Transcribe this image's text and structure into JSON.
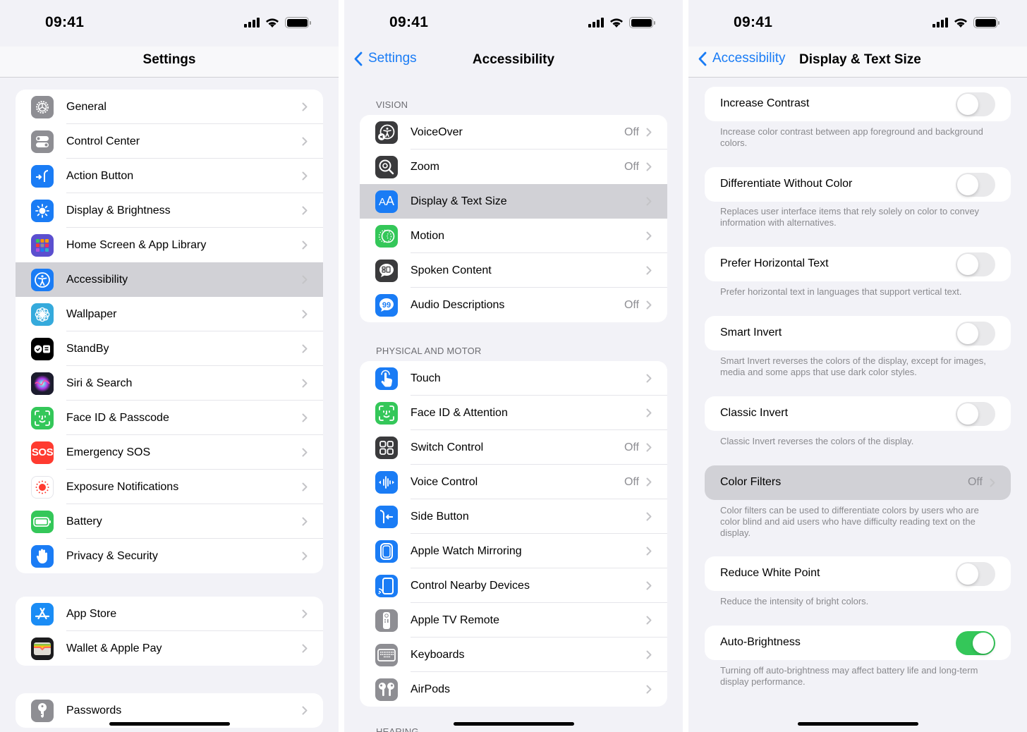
{
  "status": {
    "time": "09:41"
  },
  "colors": {
    "accent": "#1a7cf5",
    "toggle_on": "#34c759",
    "selected_row": "#d1d1d6"
  },
  "settings": {
    "title": "Settings",
    "groups": [
      {
        "items": [
          {
            "label": "General",
            "icon": "gear-icon",
            "color": "#8e8e93"
          },
          {
            "label": "Control Center",
            "icon": "switches-icon",
            "color": "#8e8e93"
          },
          {
            "label": "Action Button",
            "icon": "action-button-icon",
            "color": "#1a7cf5"
          },
          {
            "label": "Display & Brightness",
            "icon": "sun-icon",
            "color": "#1a7cf5"
          },
          {
            "label": "Home Screen & App Library",
            "icon": "app-grid-icon",
            "color": "#5b4fcf"
          },
          {
            "label": "Accessibility",
            "icon": "accessibility-icon",
            "color": "#1a7cf5",
            "selected": true
          },
          {
            "label": "Wallpaper",
            "icon": "flower-icon",
            "color": "#35aadc"
          },
          {
            "label": "StandBy",
            "icon": "standby-icon",
            "color": "#000000"
          },
          {
            "label": "Siri & Search",
            "icon": "siri-icon",
            "color": "#1c1c2e"
          },
          {
            "label": "Face ID & Passcode",
            "icon": "face-id-icon",
            "color": "#34c759"
          },
          {
            "label": "Emergency SOS",
            "icon": "sos-icon",
            "color": "#ff3b30",
            "glyph": "SOS"
          },
          {
            "label": "Exposure Notifications",
            "icon": "exposure-icon",
            "color": "#ffffff"
          },
          {
            "label": "Battery",
            "icon": "battery-icon",
            "color": "#34c759"
          },
          {
            "label": "Privacy & Security",
            "icon": "hand-icon",
            "color": "#1a7cf5"
          }
        ]
      },
      {
        "items": [
          {
            "label": "App Store",
            "icon": "app-store-icon",
            "color": "#1a8cf5"
          },
          {
            "label": "Wallet & Apple Pay",
            "icon": "wallet-icon",
            "color": "#1c1c1e"
          }
        ]
      },
      {
        "items": [
          {
            "label": "Passwords",
            "icon": "key-icon",
            "color": "#8e8e93"
          }
        ]
      }
    ]
  },
  "accessibility": {
    "back_label": "Settings",
    "title": "Accessibility",
    "sections": [
      {
        "header": "VISION",
        "items": [
          {
            "label": "VoiceOver",
            "value": "Off",
            "icon": "voiceover-icon",
            "color": "#3a3a3c"
          },
          {
            "label": "Zoom",
            "value": "Off",
            "icon": "zoom-icon",
            "color": "#3a3a3c"
          },
          {
            "label": "Display & Text Size",
            "value": "",
            "icon": "text-size-icon",
            "color": "#1a7cf5",
            "selected": true,
            "glyph": "AA"
          },
          {
            "label": "Motion",
            "value": "",
            "icon": "motion-icon",
            "color": "#34c759"
          },
          {
            "label": "Spoken Content",
            "value": "",
            "icon": "spoken-content-icon",
            "color": "#3a3a3c"
          },
          {
            "label": "Audio Descriptions",
            "value": "Off",
            "icon": "audio-descriptions-icon",
            "color": "#1a7cf5"
          }
        ]
      },
      {
        "header": "PHYSICAL AND MOTOR",
        "items": [
          {
            "label": "Touch",
            "value": "",
            "icon": "touch-icon",
            "color": "#1a7cf5"
          },
          {
            "label": "Face ID & Attention",
            "value": "",
            "icon": "face-id-icon",
            "color": "#34c759"
          },
          {
            "label": "Switch Control",
            "value": "Off",
            "icon": "switch-control-icon",
            "color": "#3a3a3c"
          },
          {
            "label": "Voice Control",
            "value": "Off",
            "icon": "voice-control-icon",
            "color": "#1a7cf5"
          },
          {
            "label": "Side Button",
            "value": "",
            "icon": "side-button-icon",
            "color": "#1a7cf5"
          },
          {
            "label": "Apple Watch Mirroring",
            "value": "",
            "icon": "watch-icon",
            "color": "#1a7cf5"
          },
          {
            "label": "Control Nearby Devices",
            "value": "",
            "icon": "nearby-devices-icon",
            "color": "#1a7cf5"
          },
          {
            "label": "Apple TV Remote",
            "value": "",
            "icon": "remote-icon",
            "color": "#8e8e93"
          },
          {
            "label": "Keyboards",
            "value": "",
            "icon": "keyboard-icon",
            "color": "#8e8e93"
          },
          {
            "label": "AirPods",
            "value": "",
            "icon": "airpods-icon",
            "color": "#8e8e93"
          }
        ]
      },
      {
        "header": "HEARING",
        "items": []
      }
    ]
  },
  "display_text_size": {
    "back_label": "Accessibility",
    "title": "Display & Text Size",
    "options": [
      {
        "label": "Increase Contrast",
        "type": "toggle",
        "on": false,
        "footnote": "Increase color contrast between app foreground and background colors."
      },
      {
        "label": "Differentiate Without Color",
        "type": "toggle",
        "on": false,
        "footnote": "Replaces user interface items that rely solely on color to convey information with alternatives."
      },
      {
        "label": "Prefer Horizontal Text",
        "type": "toggle",
        "on": false,
        "footnote": "Prefer horizontal text in languages that support vertical text."
      },
      {
        "label": "Smart Invert",
        "type": "toggle",
        "on": false,
        "footnote": "Smart Invert reverses the colors of the display, except for images, media and some apps that use dark color styles."
      },
      {
        "label": "Classic Invert",
        "type": "toggle",
        "on": false,
        "footnote": "Classic Invert reverses the colors of the display."
      },
      {
        "label": "Color Filters",
        "type": "link",
        "value": "Off",
        "selected": true,
        "footnote": "Color filters can be used to differentiate colors by users who are color blind and aid users who have difficulty reading text on the display."
      },
      {
        "label": "Reduce White Point",
        "type": "toggle",
        "on": false,
        "footnote": "Reduce the intensity of bright colors."
      },
      {
        "label": "Auto-Brightness",
        "type": "toggle",
        "on": true,
        "footnote": "Turning off auto-brightness may affect battery life and long-term display performance."
      }
    ]
  }
}
